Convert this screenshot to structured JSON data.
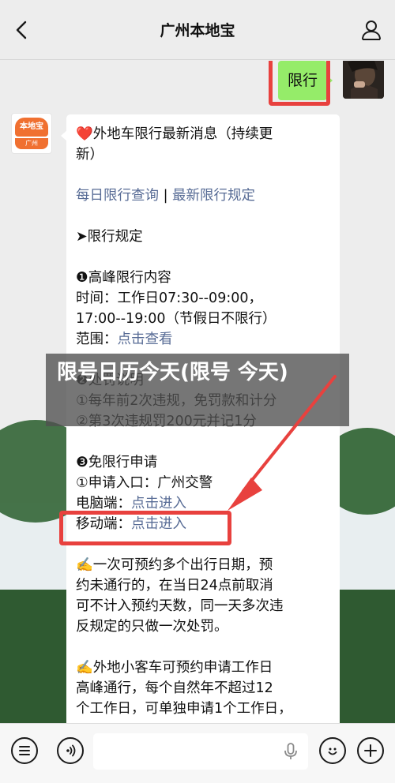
{
  "header": {
    "title": "广州本地宝"
  },
  "my_message": {
    "text": "限行"
  },
  "bot_avatar": {
    "logo_text": "本地宝",
    "logo_sub": "广州"
  },
  "message": {
    "lines": [
      {
        "type": "text",
        "text": "❤️外地车限行最新消息（持续更"
      },
      {
        "type": "text",
        "text": "新）"
      },
      {
        "type": "gap"
      },
      {
        "type": "links",
        "parts": [
          "每日限行查询",
          " | ",
          "最新限行规定"
        ]
      },
      {
        "type": "gap"
      },
      {
        "type": "text",
        "text": "➤限行规定"
      },
      {
        "type": "gap"
      },
      {
        "type": "text",
        "text": "❶高峰限行内容"
      },
      {
        "type": "text",
        "text": "时间：工作日07:30--09:00，"
      },
      {
        "type": "text",
        "text": "17:00--19:00（节假日不限行）"
      },
      {
        "type": "labellink",
        "label": "范围：",
        "link": "点击查看"
      },
      {
        "type": "gap"
      },
      {
        "type": "text",
        "text": "❷处罚说明"
      },
      {
        "type": "text",
        "text": "①每年前2次违规，免罚款和计分"
      },
      {
        "type": "text",
        "text": "②第3次违规罚200元并记1分"
      },
      {
        "type": "gap"
      },
      {
        "type": "text",
        "text": "❸免限行申请"
      },
      {
        "type": "text",
        "text": "①申请入口：广州交警"
      },
      {
        "type": "labellink",
        "label": "电脑端：",
        "link": "点击进入"
      },
      {
        "type": "labellink",
        "label": "移动端：",
        "link": "点击进入"
      },
      {
        "type": "gap"
      },
      {
        "type": "text",
        "text": "✍️一次可预约多个出行日期，预"
      },
      {
        "type": "text",
        "text": "约未通行的，在当日24点前取消"
      },
      {
        "type": "text",
        "text": "可不计入预约天数，同一天多次违"
      },
      {
        "type": "text",
        "text": "反规定的只做一次处罚。"
      },
      {
        "type": "gap"
      },
      {
        "type": "text",
        "text": "✍️外地小客车可预约申请工作日"
      },
      {
        "type": "text",
        "text": "高峰通行，每个自然年不超过12"
      },
      {
        "type": "text",
        "text": "个工作日，可单独申请1个工作日，"
      }
    ]
  },
  "overlay": {
    "title": "限号日历今天(限号 今天)"
  },
  "colors": {
    "accent_red": "#e8413e",
    "bubble_green": "#95ec69",
    "link_blue": "#576b95"
  },
  "input_bar": {
    "icons": [
      "menu-list-icon",
      "voice-icon",
      "emoji-icon",
      "plus-icon"
    ]
  }
}
